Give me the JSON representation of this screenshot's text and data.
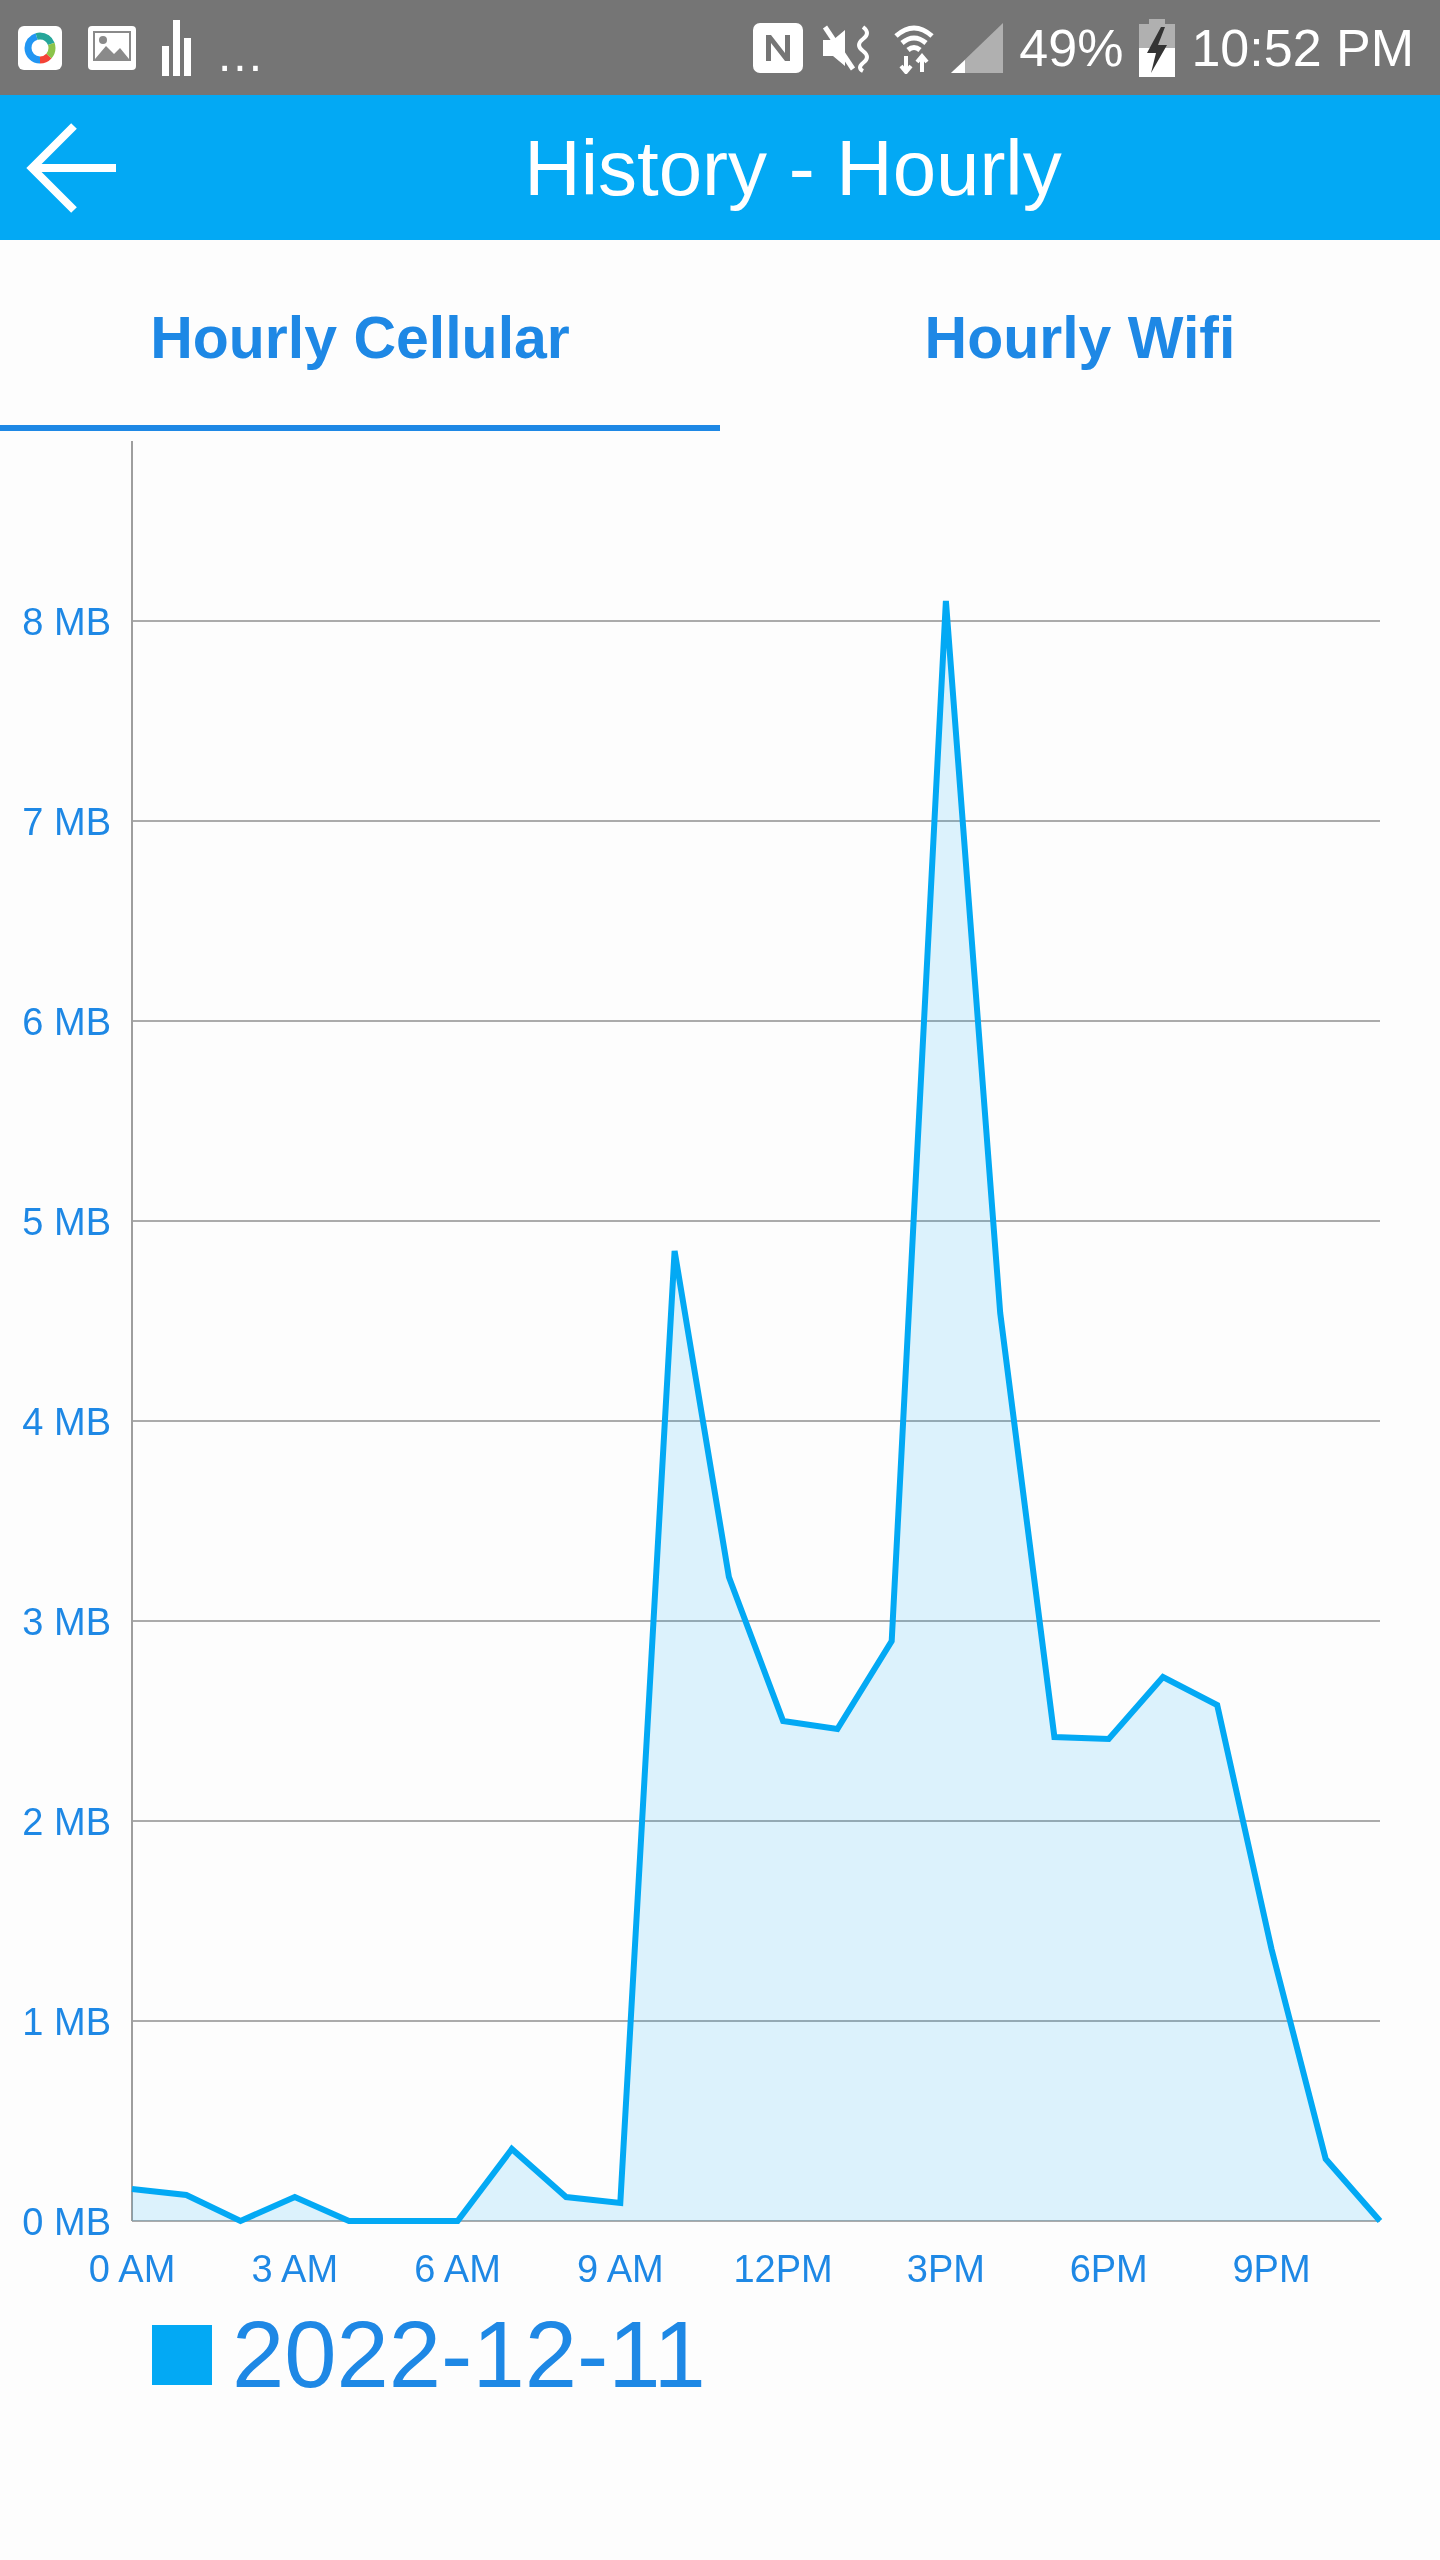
{
  "status_bar": {
    "overflow": "...",
    "battery": "49%",
    "time": "10:52 PM"
  },
  "app_bar": {
    "title": "History - Hourly"
  },
  "tabs": [
    {
      "label": "Hourly Cellular",
      "selected": true
    },
    {
      "label": "Hourly Wifi",
      "selected": false
    }
  ],
  "chart": {
    "chart_data": {
      "type": "area",
      "categories": [
        "0 AM",
        null,
        null,
        "3 AM",
        null,
        null,
        "6 AM",
        null,
        null,
        "9 AM",
        null,
        null,
        "12PM",
        null,
        null,
        "3PM",
        null,
        null,
        "6PM",
        null,
        null,
        "9PM",
        null,
        null
      ],
      "series": [
        {
          "name": "2022-12-11",
          "color": "#03a9f4",
          "values": [
            0.16,
            0.13,
            0,
            0.12,
            0,
            0,
            0,
            0.36,
            0.12,
            0.09,
            4.85,
            3.22,
            2.5,
            2.46,
            2.9,
            8.1,
            4.54,
            2.42,
            2.41,
            2.72,
            2.58,
            1.36,
            0.31,
            0
          ]
        }
      ],
      "ylim": [
        0,
        8.9
      ],
      "yticks": [
        {
          "value": 0,
          "label": "0 MB"
        },
        {
          "value": 1,
          "label": "1 MB"
        },
        {
          "value": 2,
          "label": "2 MB"
        },
        {
          "value": 3,
          "label": "3 MB"
        },
        {
          "value": 4,
          "label": "4 MB"
        },
        {
          "value": 5,
          "label": "5 MB"
        },
        {
          "value": 6,
          "label": "6 MB"
        },
        {
          "value": 7,
          "label": "7 MB"
        },
        {
          "value": 8,
          "label": "8 MB"
        }
      ],
      "grid": true
    }
  }
}
